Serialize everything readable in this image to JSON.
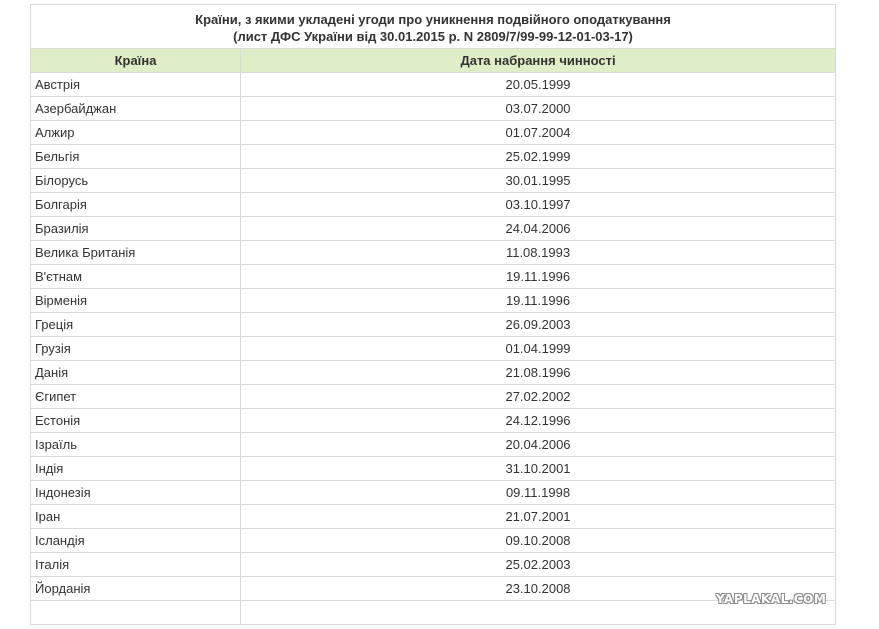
{
  "table": {
    "title_line1": "Країни, з якими укладені угоди про уникнення подвійного оподаткування",
    "title_line2": "(лист ДФС України від 30.01.2015 р. N 2809/7/99-99-12-01-03-17)",
    "headers": {
      "country": "Країна",
      "date": "Дата набрання чинності"
    },
    "rows": [
      {
        "country": "Австрія",
        "date": "20.05.1999"
      },
      {
        "country": "Азербайджан",
        "date": "03.07.2000"
      },
      {
        "country": "Алжир",
        "date": "01.07.2004"
      },
      {
        "country": "Бельгія",
        "date": "25.02.1999"
      },
      {
        "country": "Білорусь",
        "date": "30.01.1995"
      },
      {
        "country": "Болгарія",
        "date": "03.10.1997"
      },
      {
        "country": "Бразилія",
        "date": "24.04.2006"
      },
      {
        "country": "Велика Британія",
        "date": "11.08.1993"
      },
      {
        "country": "В'єтнам",
        "date": "19.11.1996"
      },
      {
        "country": "Вірменія",
        "date": "19.11.1996"
      },
      {
        "country": "Греція",
        "date": "26.09.2003"
      },
      {
        "country": "Грузія",
        "date": "01.04.1999"
      },
      {
        "country": "Данія",
        "date": "21.08.1996"
      },
      {
        "country": "Єгипет",
        "date": "27.02.2002"
      },
      {
        "country": "Естонія",
        "date": "24.12.1996"
      },
      {
        "country": "Ізраїль",
        "date": "20.04.2006"
      },
      {
        "country": "Індія",
        "date": "31.10.2001"
      },
      {
        "country": "Індонезія",
        "date": "09.11.1998"
      },
      {
        "country": "Іран",
        "date": "21.07.2001"
      },
      {
        "country": "Ісландія",
        "date": "09.10.2008"
      },
      {
        "country": "Італія",
        "date": "25.02.2003"
      },
      {
        "country": "Йорданія",
        "date": "23.10.2008"
      },
      {
        "country": "",
        "date": ""
      }
    ]
  },
  "watermark": {
    "text": "YAPLAKAL.COM"
  },
  "colors": {
    "header_bg": "#dfeec6",
    "border": "#d9d9d9",
    "text": "#333333"
  }
}
